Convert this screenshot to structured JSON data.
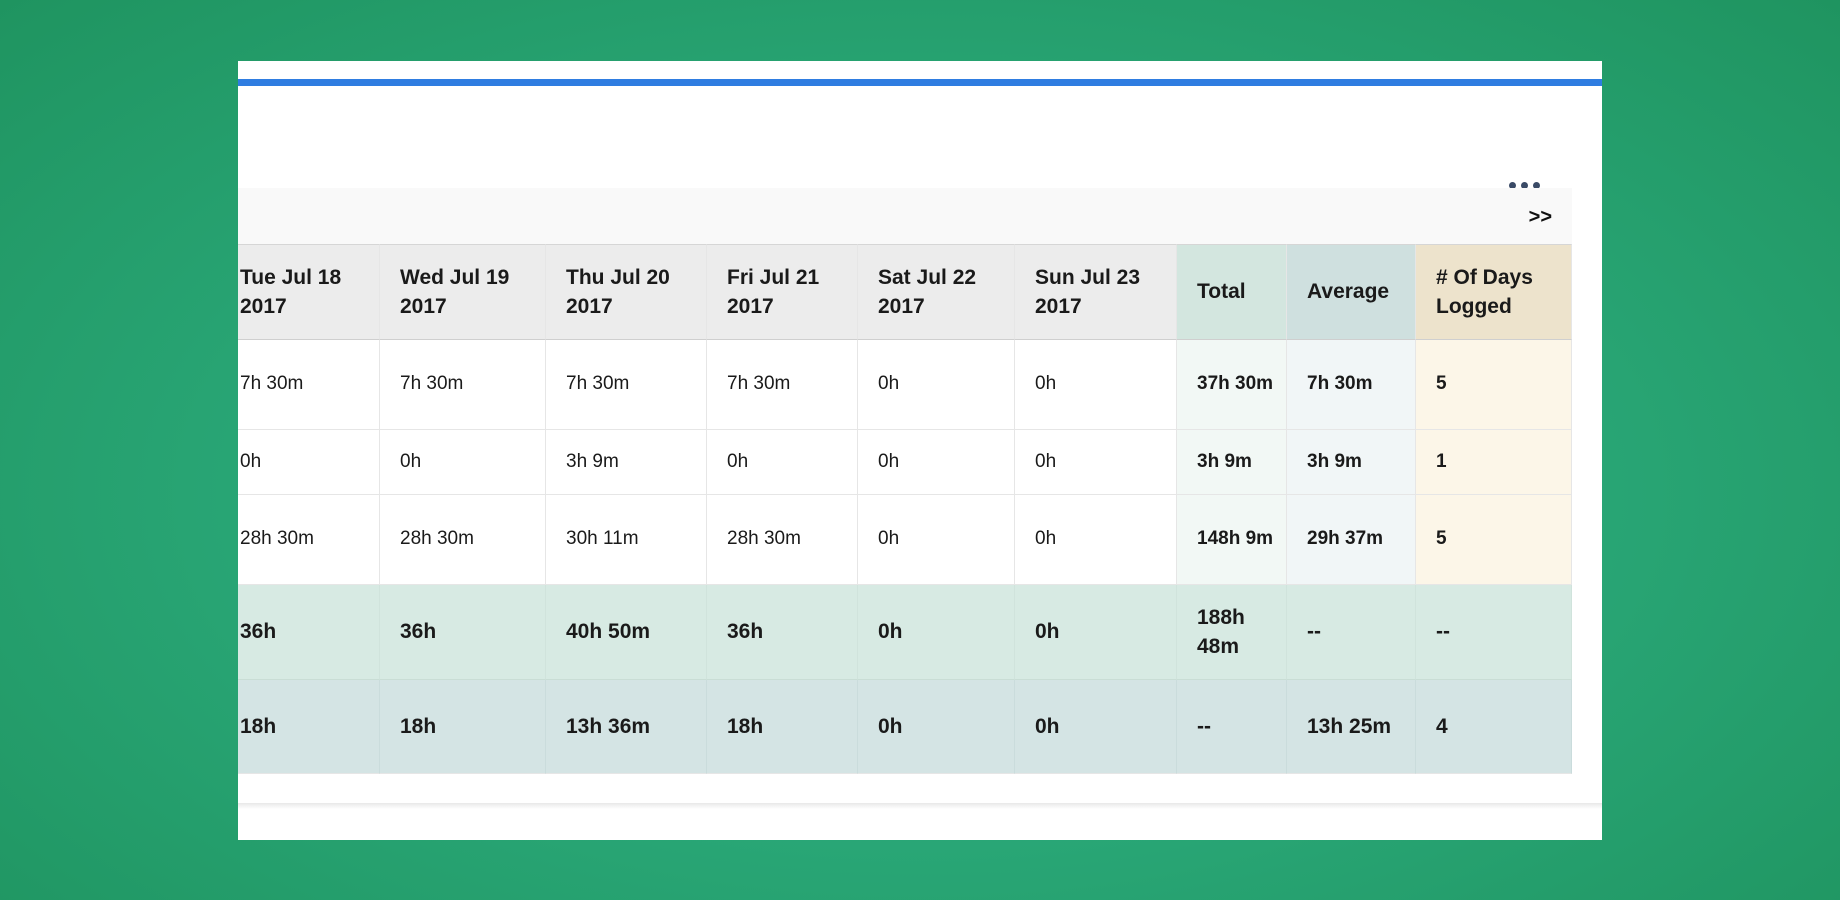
{
  "header": {
    "menu_icon": "more-horizontal-icon"
  },
  "nav": {
    "next_label": ">>"
  },
  "table": {
    "columns": [
      {
        "label": "Tue Jul 18 2017"
      },
      {
        "label": "Wed Jul 19 2017"
      },
      {
        "label": "Thu Jul 20 2017"
      },
      {
        "label": "Fri Jul 21 2017"
      },
      {
        "label": "Sat Jul 22 2017"
      },
      {
        "label": "Sun Jul 23 2017"
      },
      {
        "label": "Total"
      },
      {
        "label": "Average"
      },
      {
        "label": "# Of Days Logged"
      }
    ],
    "rows": [
      {
        "cells": [
          "7h 30m",
          "7h 30m",
          "7h 30m",
          "7h 30m",
          "0h",
          "0h",
          "37h 30m",
          "7h 30m",
          "5"
        ]
      },
      {
        "cells": [
          "0h",
          "0h",
          "3h 9m",
          "0h",
          "0h",
          "0h",
          "3h 9m",
          "3h 9m",
          "1"
        ]
      },
      {
        "cells": [
          "28h 30m",
          "28h 30m",
          "30h 11m",
          "28h 30m",
          "0h",
          "0h",
          "148h 9m",
          "29h 37m",
          "5"
        ]
      }
    ],
    "total_row": {
      "cells": [
        "36h",
        "36h",
        "40h 50m",
        "36h",
        "0h",
        "0h",
        "188h 48m",
        "--",
        "--"
      ]
    },
    "average_row": {
      "cells": [
        "18h",
        "18h",
        "13h 36m",
        "18h",
        "0h",
        "0h",
        "--",
        "13h 25m",
        "4"
      ]
    }
  },
  "colors": {
    "accent_bar": "#2f7de1",
    "total_header": "#d3e6df",
    "average_header": "#cfe0df",
    "days_header": "#ede3cc",
    "total_row": "#d7eae3",
    "average_row": "#d4e4e4"
  }
}
